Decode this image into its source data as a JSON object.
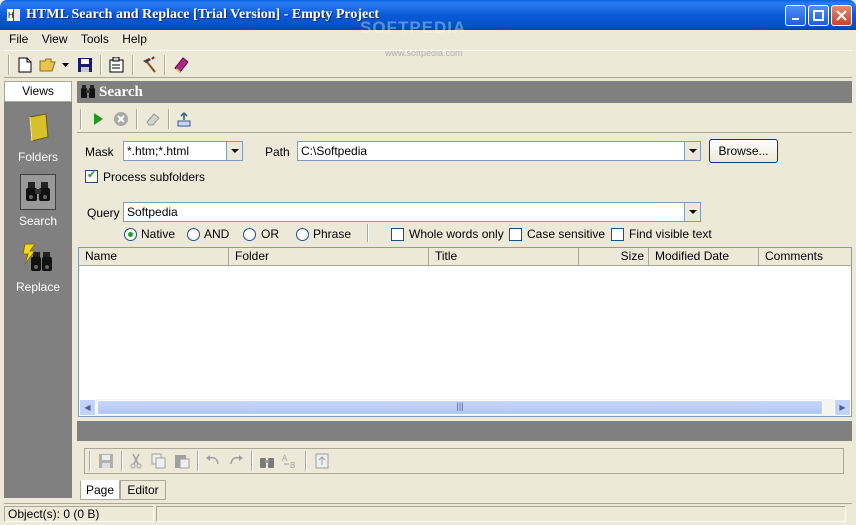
{
  "window": {
    "title": "HTML Search and Replace [Trial Version] - Empty Project",
    "watermark": "SOFTPEDIA",
    "watermark_url": "www.softpedia.com"
  },
  "menu": [
    "File",
    "View",
    "Tools",
    "Help"
  ],
  "views": {
    "tab_label": "Views",
    "items": [
      {
        "label": "Folders",
        "icon": "folder-icon"
      },
      {
        "label": "Search",
        "icon": "binoculars-icon",
        "selected": true
      },
      {
        "label": "Replace",
        "icon": "replace-icon"
      }
    ]
  },
  "search": {
    "header": "Search",
    "mask_label": "Mask",
    "mask_value": "*.htm;*.html",
    "path_label": "Path",
    "path_value": "C:\\Softpedia",
    "browse_label": "Browse...",
    "process_subfolders_label": "Process subfolders",
    "process_subfolders_checked": true,
    "query_label": "Query",
    "query_value": "Softpedia",
    "modes": [
      {
        "label": "Native",
        "selected": true
      },
      {
        "label": "AND",
        "selected": false
      },
      {
        "label": "OR",
        "selected": false
      },
      {
        "label": "Phrase",
        "selected": false
      }
    ],
    "options": [
      {
        "label": "Whole words only",
        "checked": false
      },
      {
        "label": "Case sensitive",
        "checked": false
      },
      {
        "label": "Find visible text",
        "checked": false
      }
    ]
  },
  "results": {
    "columns": [
      "Name",
      "Folder",
      "Title",
      "Size",
      "Modified Date",
      "Comments"
    ]
  },
  "editor_tabs": [
    "Page",
    "Editor"
  ],
  "status": {
    "objects": "Object(s): 0 (0 B)"
  },
  "colors": {
    "titlebar": "#0a5ad8",
    "panel_gray": "#808080",
    "accent_green": "#21a121"
  }
}
